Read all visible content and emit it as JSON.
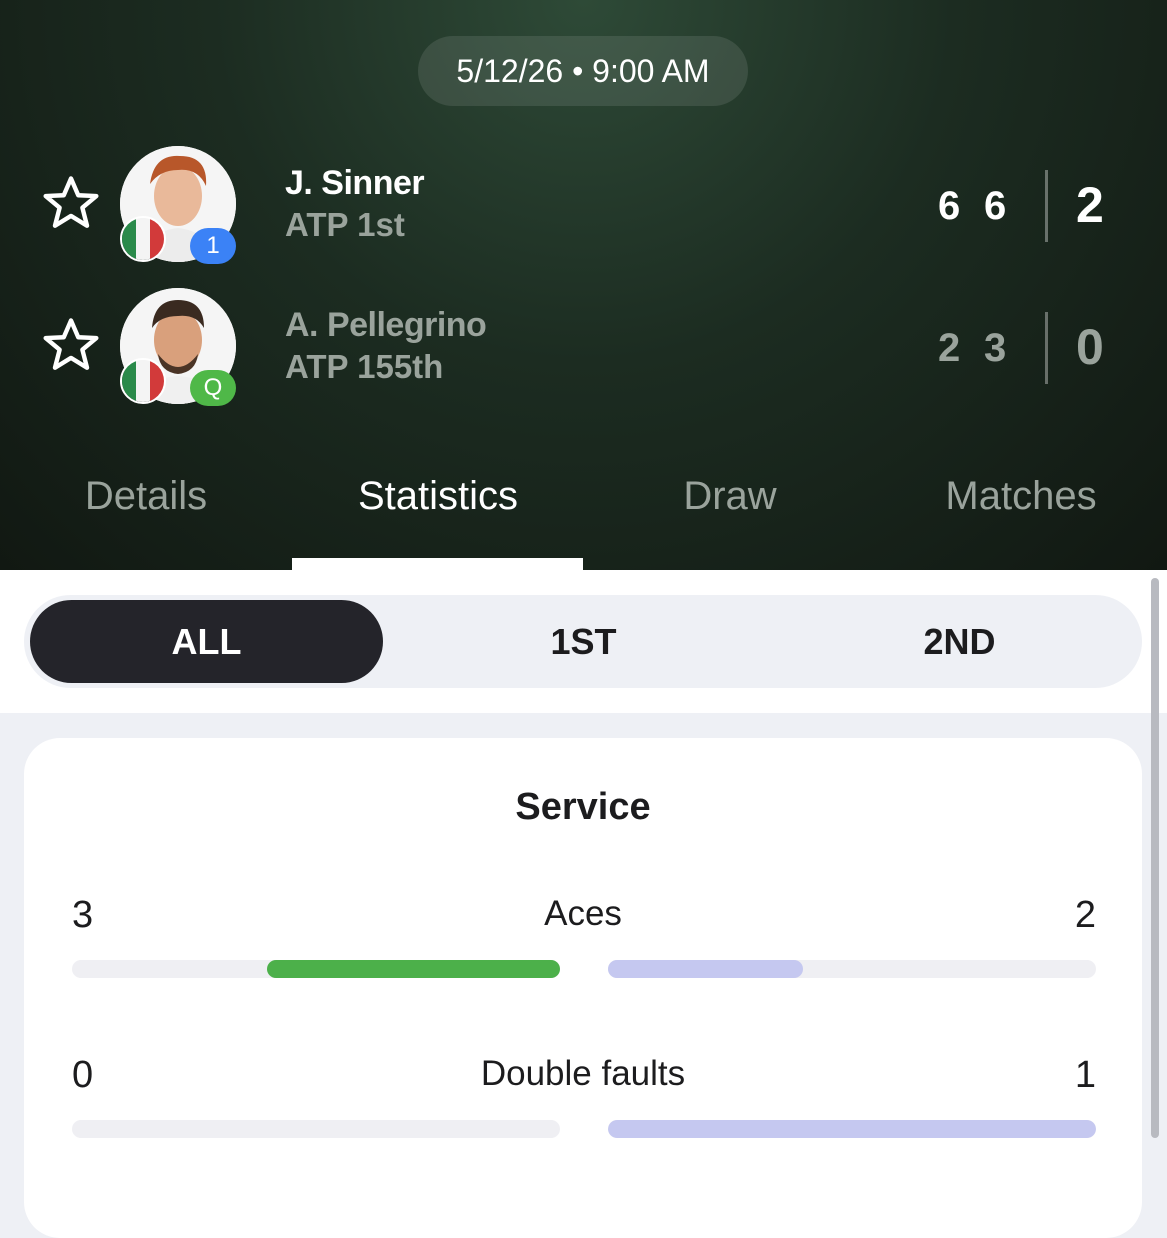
{
  "match": {
    "datetime": "5/12/26 • 9:00 AM"
  },
  "players": [
    {
      "name": "J. Sinner",
      "rank": "ATP 1st",
      "seed_badge": "1",
      "badge_color": "#3b82f6",
      "set1": "6",
      "set2": "6",
      "sets_won": "2",
      "nationality_flag": "italy",
      "highlight": true
    },
    {
      "name": "A. Pellegrino",
      "rank": "ATP 155th",
      "seed_badge": "Q",
      "badge_color": "#4fb848",
      "set1": "2",
      "set2": "3",
      "sets_won": "0",
      "nationality_flag": "italy",
      "highlight": false
    }
  ],
  "tabs": [
    {
      "label": "Details",
      "active": false
    },
    {
      "label": "Statistics",
      "active": true
    },
    {
      "label": "Draw",
      "active": false
    },
    {
      "label": "Matches",
      "active": false
    }
  ],
  "segments": [
    {
      "label": "ALL",
      "active": true
    },
    {
      "label": "1ST",
      "active": false
    },
    {
      "label": "2ND",
      "active": false
    }
  ],
  "section": {
    "title": "Service"
  },
  "stats": [
    {
      "label": "Aces",
      "left": "3",
      "right": "2",
      "left_fill": 0.6,
      "right_fill": 0.4
    },
    {
      "label": "Double faults",
      "left": "0",
      "right": "1",
      "left_fill": 0.0,
      "right_fill": 1.0
    }
  ],
  "colors": {
    "left_bar": "#4cb04a",
    "right_bar": "#c5c8f0",
    "active_text": "#ffffff",
    "inactive_text": "#9aa39c",
    "header_bg": "#1c2c21"
  },
  "icons": {
    "favorite": "star-outline-icon"
  }
}
